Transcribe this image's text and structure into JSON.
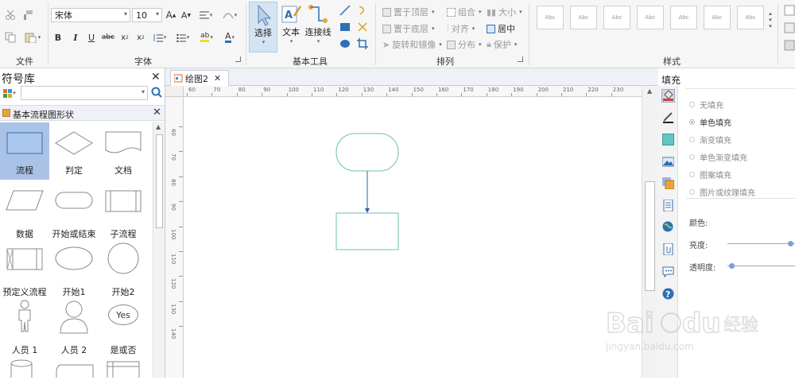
{
  "ribbon": {
    "file_group": {
      "label": "文件"
    },
    "font_group": {
      "label": "字体",
      "font_name": "宋体",
      "font_size": "10"
    },
    "tools_group": {
      "label": "基本工具",
      "select": "选择",
      "text": "文本",
      "connector": "连接线"
    },
    "arrange_group": {
      "label": "排列",
      "bring_front": "置于顶层",
      "send_back": "置于底层",
      "rotate_mirror": "旋转和镜像",
      "group": "组合",
      "align": "对齐",
      "distribute": "分布",
      "size": "大小",
      "center": "居中",
      "protect": "保护"
    },
    "style_group": {
      "label": "样式",
      "swatch_text": "Abc"
    }
  },
  "library": {
    "title": "符号库",
    "section_title": "基本流程图形状",
    "shapes": [
      {
        "label": "流程"
      },
      {
        "label": "判定"
      },
      {
        "label": "文档"
      },
      {
        "label": "数据"
      },
      {
        "label": "开始或结束"
      },
      {
        "label": "子流程"
      },
      {
        "label": "预定义流程"
      },
      {
        "label": "开始1"
      },
      {
        "label": "开始2"
      },
      {
        "label": "人员 1"
      },
      {
        "label": "人员 2"
      },
      {
        "label": "是或否",
        "inner_text": "Yes"
      }
    ]
  },
  "document": {
    "tab_title": "绘图2",
    "hruler_ticks": [
      "60",
      "70",
      "80",
      "90",
      "100",
      "110",
      "120",
      "130",
      "140",
      "150",
      "160",
      "170",
      "180",
      "190",
      "200",
      "210",
      "220",
      "230"
    ],
    "vruler_ticks": [
      "60",
      "70",
      "80",
      "90",
      "100",
      "110",
      "120",
      "130",
      "140"
    ]
  },
  "fill_panel": {
    "title": "填充",
    "options": [
      "无填充",
      "单色填充",
      "渐变填充",
      "单色渐变填充",
      "图案填充",
      "图片或纹理填充"
    ],
    "selected_option": "单色填充",
    "color_label": "颜色:",
    "brightness_label": "亮度:",
    "transparency_label": "透明度:",
    "brightness_value": 0.98,
    "transparency_value": 0.02
  },
  "colors": {
    "accent_blue": "#2f6fb3",
    "shape_stroke": "#6cc2b0",
    "selected_shape_bg": "#a9c7ee",
    "connector": "#2f5fa5"
  }
}
